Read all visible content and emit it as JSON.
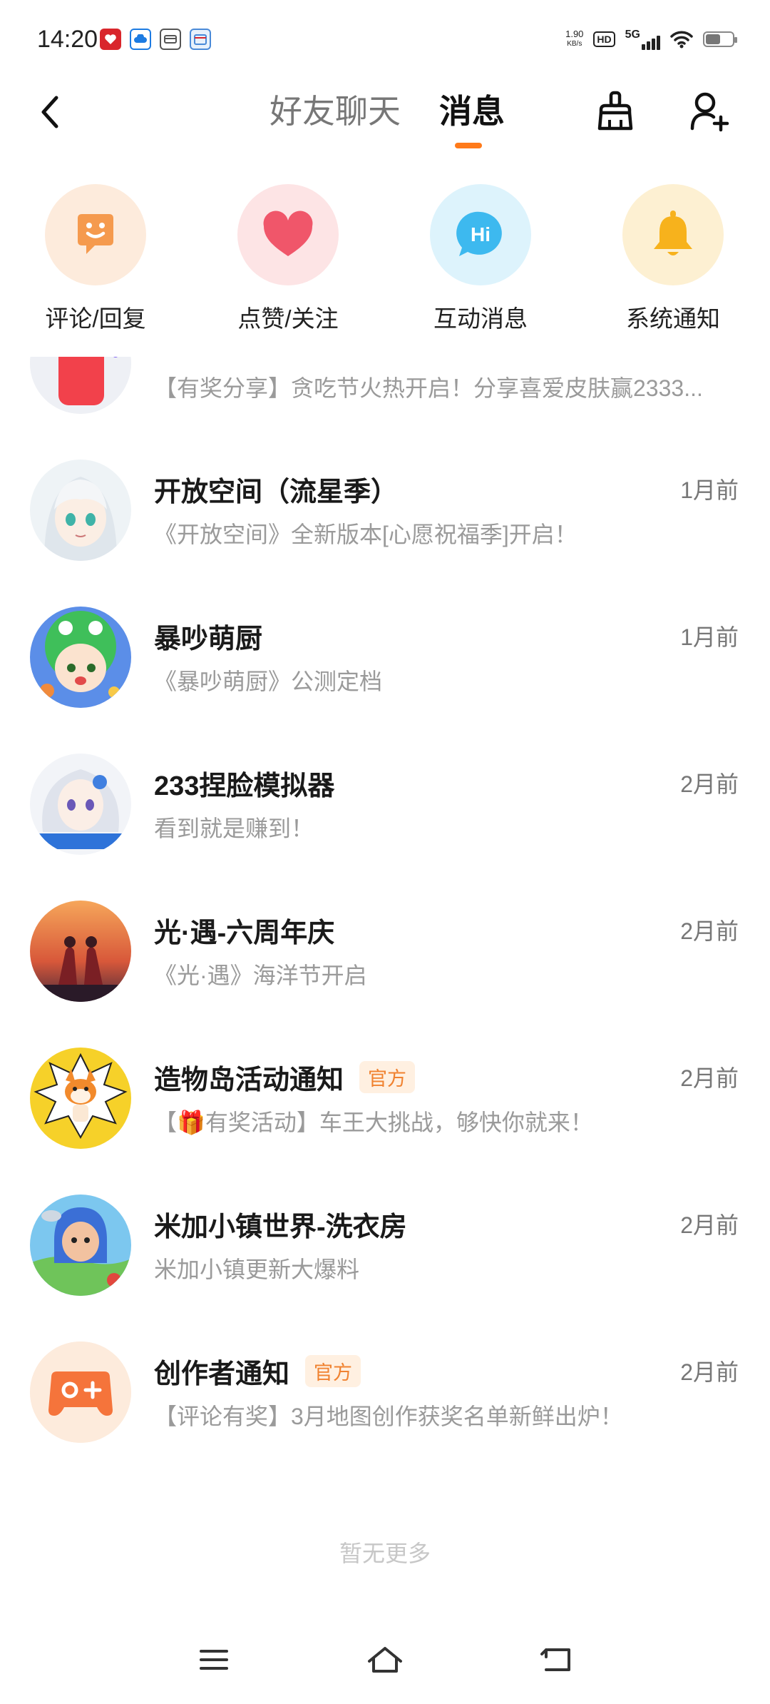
{
  "status_bar": {
    "time": "14:20",
    "net_speed_value": "1.90",
    "net_speed_unit": "KB/s",
    "hd": "HD",
    "network": "5G",
    "battery_level": 0.55,
    "app_icons": [
      "heart-badge-icon",
      "cloud-app-icon",
      "wallet-app-icon",
      "calendar-app-icon"
    ]
  },
  "header": {
    "tabs": [
      {
        "label": "好友聊天",
        "active": false
      },
      {
        "label": "消息",
        "active": true
      }
    ],
    "accent": "#ff7a1a"
  },
  "categories": [
    {
      "label": "评论/回复",
      "icon": "comment-smile-icon",
      "bg": "#fdebdc",
      "color": "#f59a4e"
    },
    {
      "label": "点赞/关注",
      "icon": "heart-icon",
      "bg": "#fde4e5",
      "color": "#f0566a"
    },
    {
      "label": "互动消息",
      "icon": "hi-bubble-icon",
      "bg": "#ddf3fc",
      "color": "#3db9ef"
    },
    {
      "label": "系统通知",
      "icon": "bell-icon",
      "bg": "#fdf0d2",
      "color": "#f7b21c"
    }
  ],
  "messages": [
    {
      "title": "",
      "preview": "【有奖分享】贪吃节火热开启！分享喜爱皮肤赢2333...",
      "time": "",
      "official": false,
      "avatar": "red-monster-avatar"
    },
    {
      "title": "开放空间（流星季）",
      "preview": "《开放空间》全新版本[心愿祝福季]开启！",
      "time": "1月前",
      "official": false,
      "avatar": "anime-girl-avatar"
    },
    {
      "title": "暴吵萌厨",
      "preview": "《暴吵萌厨》公测定档",
      "time": "1月前",
      "official": false,
      "avatar": "dino-chef-avatar"
    },
    {
      "title": "233捏脸模拟器",
      "preview": "看到就是赚到！",
      "time": "2月前",
      "official": false,
      "avatar": "face-sim-avatar"
    },
    {
      "title": "光·遇-六周年庆",
      "preview": "《光·遇》海洋节开启",
      "time": "2月前",
      "official": false,
      "avatar": "sky-sunset-avatar"
    },
    {
      "title": "造物岛活动通知",
      "preview": "【🎁有奖活动】车王大挑战，够快你就来！",
      "time": "2月前",
      "official": true,
      "official_label": "官方",
      "avatar": "fox-mascot-avatar"
    },
    {
      "title": "米加小镇世界-洗衣房",
      "preview": "米加小镇更新大爆料",
      "time": "2月前",
      "official": false,
      "avatar": "miga-town-avatar"
    },
    {
      "title": "创作者通知",
      "preview": "【评论有奖】3月地图创作获奖名单新鲜出炉！",
      "time": "2月前",
      "official": true,
      "official_label": "官方",
      "avatar": "gamepad-icon"
    }
  ],
  "footer": {
    "no_more": "暂无更多"
  }
}
